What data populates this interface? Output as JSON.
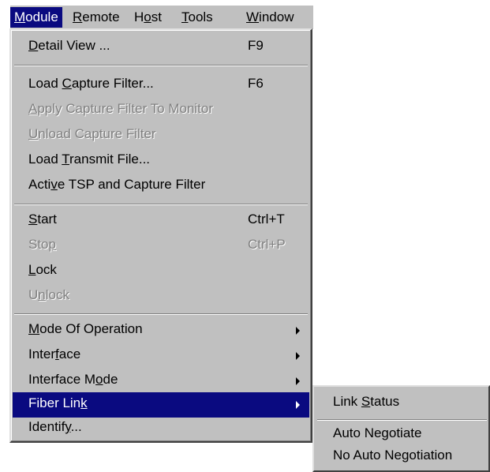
{
  "menubar": {
    "items": [
      {
        "label": "Module",
        "key": "M",
        "rest": "odule"
      },
      {
        "label": "Remote",
        "key": "R",
        "rest": "emote"
      },
      {
        "label": "Host",
        "pre": "H",
        "key": "o",
        "rest": "st"
      },
      {
        "label": "Tools",
        "key": "T",
        "rest": "ools"
      },
      {
        "label": "Window",
        "key": "W",
        "rest": "indow"
      }
    ]
  },
  "menu": {
    "items": [
      {
        "pre": "",
        "key": "D",
        "rest": "etail View ...",
        "shortcut": "F9"
      },
      {
        "pre": "Load ",
        "key": "C",
        "rest": "apture Filter...",
        "shortcut": "F6"
      },
      {
        "pre": "",
        "key": "A",
        "rest": "pply Capture Filter To Monitor"
      },
      {
        "pre": "",
        "key": "U",
        "rest": "nload Capture Filter"
      },
      {
        "pre": "Load ",
        "key": "T",
        "rest": "ransmit File..."
      },
      {
        "pre": "Acti",
        "key": "v",
        "rest": "e TSP and Capture Filter"
      },
      {
        "pre": "",
        "key": "S",
        "rest": "tart",
        "shortcut": "Ctrl+T"
      },
      {
        "pre": "Sto",
        "key": "p",
        "rest": "",
        "shortcut": "Ctrl+P"
      },
      {
        "pre": "",
        "key": "L",
        "rest": "ock"
      },
      {
        "pre": "U",
        "key": "n",
        "rest": "lock"
      },
      {
        "pre": "",
        "key": "M",
        "rest": "ode Of Operation"
      },
      {
        "pre": "Inter",
        "key": "f",
        "rest": "ace"
      },
      {
        "pre": "Interface M",
        "key": "o",
        "rest": "de"
      },
      {
        "pre": "Fiber Lin",
        "key": "k",
        "rest": ""
      },
      {
        "pre": "Identif",
        "key": "y",
        "rest": "..."
      }
    ]
  },
  "submenu": {
    "items": [
      {
        "pre": "Link ",
        "key": "S",
        "rest": "tatus"
      },
      {
        "label": "Auto Negotiate"
      },
      {
        "label": "No Auto Negotiation"
      }
    ]
  }
}
